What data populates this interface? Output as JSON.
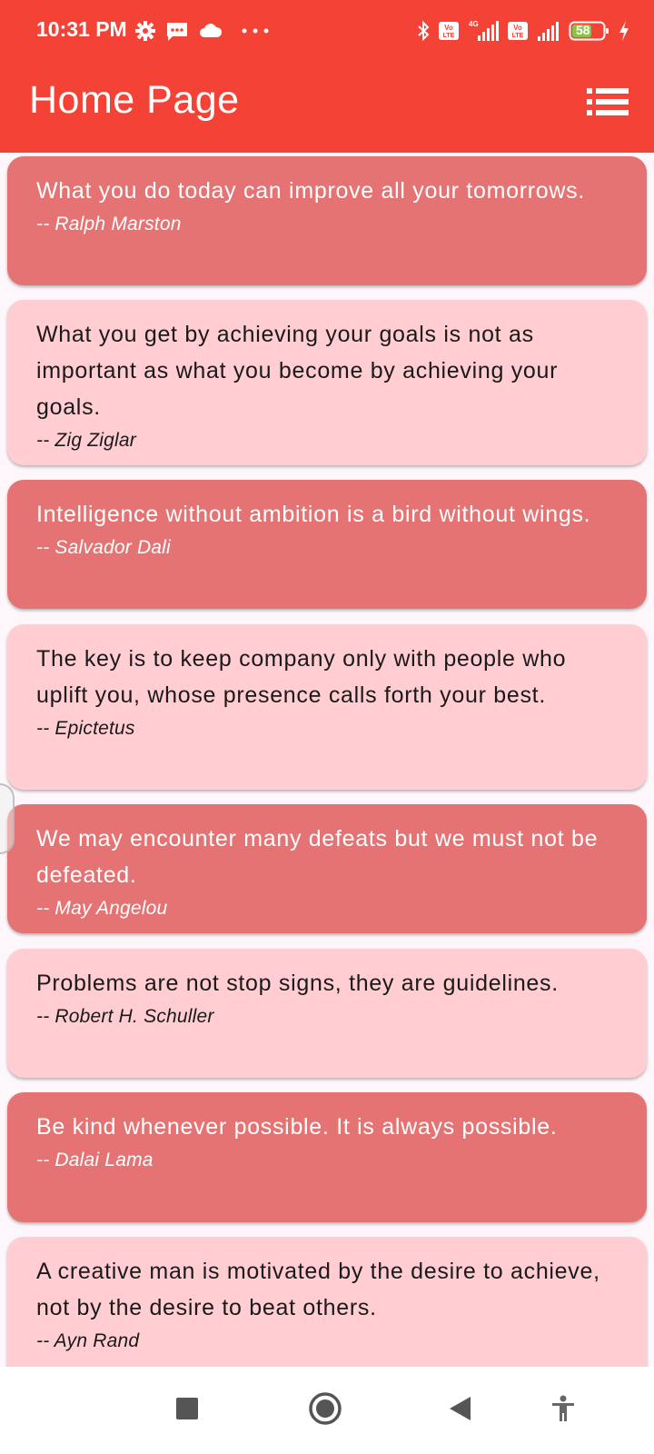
{
  "status_bar": {
    "time": "10:31 PM",
    "battery_level": "58",
    "icons": [
      "settings-icon",
      "message-icon",
      "cloud-icon",
      "more-dots-icon",
      "bluetooth-icon",
      "volte-icon",
      "signal-4g-icon",
      "volte-icon",
      "signal-icon",
      "battery-icon",
      "charging-icon"
    ]
  },
  "app_bar": {
    "title": "Home Page",
    "menu_icon": "list-menu-icon"
  },
  "quotes": [
    {
      "text": "What you do today can improve all your tomorrows.",
      "author": "-- Ralph Marston",
      "style": "dark"
    },
    {
      "text": "What you get by achieving your goals is not as important as what you become by achieving your goals.",
      "author": "-- Zig Ziglar",
      "style": "light"
    },
    {
      "text": "Intelligence without ambition is a bird without wings.",
      "author": "-- Salvador Dali",
      "style": "dark"
    },
    {
      "text": "The key is to keep company only with people who uplift you, whose presence calls forth your best.",
      "author": "-- Epictetus",
      "style": "light"
    },
    {
      "text": "We may encounter many defeats but we must not be defeated.",
      "author": "-- May Angelou",
      "style": "dark"
    },
    {
      "text": "Problems are not stop signs, they are guidelines.",
      "author": "-- Robert H. Schuller",
      "style": "light"
    },
    {
      "text": "Be kind whenever possible. It is always possible.",
      "author": "-- Dalai Lama",
      "style": "dark"
    },
    {
      "text": "A creative man is motivated by the desire to achieve, not by the desire to beat others.",
      "author": "-- Ayn Rand",
      "style": "light"
    }
  ],
  "colors": {
    "primary": "#f44336",
    "card_dark": "#e57373",
    "card_light": "#ffcdd2"
  },
  "nav_bar": {
    "buttons": [
      "recents-square-icon",
      "home-circle-icon",
      "back-triangle-icon",
      "accessibility-icon"
    ]
  }
}
